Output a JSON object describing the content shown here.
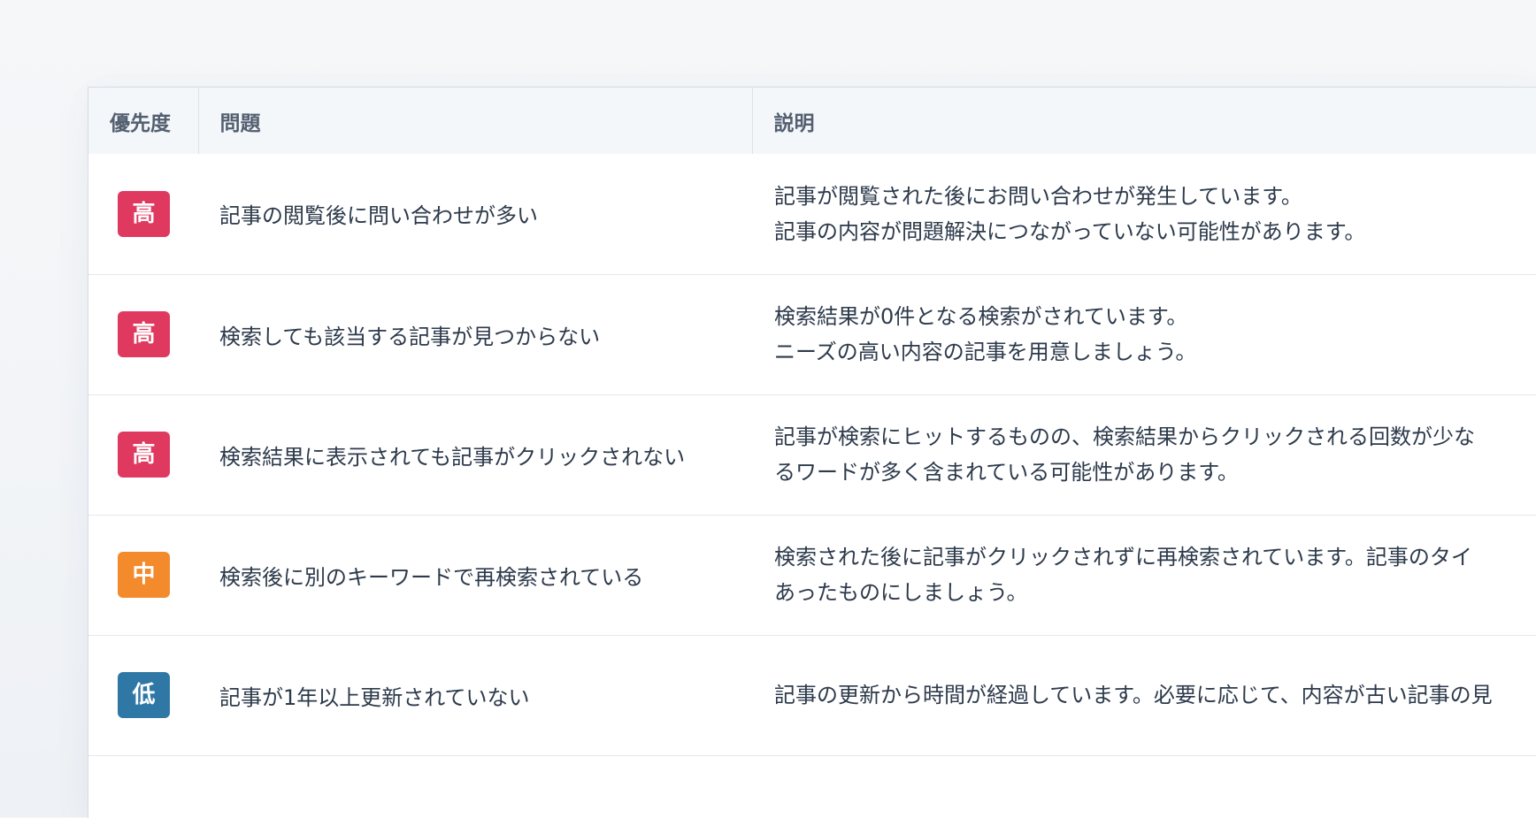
{
  "table": {
    "headers": {
      "priority": "優先度",
      "issue": "問題",
      "description": "説明"
    },
    "rows": [
      {
        "priority": "高",
        "priority_color": "#e0395f",
        "issue": "記事の閲覧後に問い合わせが多い",
        "description": [
          "記事が閲覧された後にお問い合わせが発生しています。",
          "記事の内容が問題解決につながっていない可能性があります。"
        ]
      },
      {
        "priority": "高",
        "priority_color": "#e0395f",
        "issue": "検索しても該当する記事が見つからない",
        "description": [
          "検索結果が0件となる検索がされています。",
          "ニーズの高い内容の記事を用意しましょう。"
        ]
      },
      {
        "priority": "高",
        "priority_color": "#e0395f",
        "issue": "検索結果に表示されても記事がクリックされない",
        "description": [
          "記事が検索にヒットするものの、検索結果からクリックされる回数が少な",
          "るワードが多く含まれている可能性があります。"
        ]
      },
      {
        "priority": "中",
        "priority_color": "#f38a2c",
        "issue": "検索後に別のキーワードで再検索されている",
        "description": [
          "検索された後に記事がクリックされずに再検索されています。記事のタイ",
          "あったものにしましょう。"
        ]
      },
      {
        "priority": "低",
        "priority_color": "#2f78a5",
        "issue": "記事が1年以上更新されていない",
        "description": [
          "記事の更新から時間が経過しています。必要に応じて、内容が古い記事の見"
        ]
      }
    ]
  }
}
